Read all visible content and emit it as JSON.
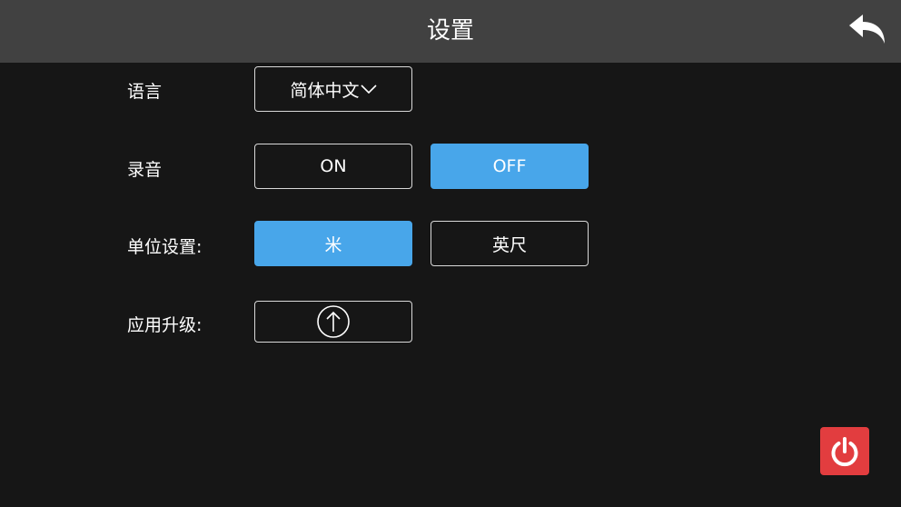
{
  "header": {
    "title": "设置"
  },
  "settings": {
    "language": {
      "label": "语言",
      "selected": "简体中文"
    },
    "recording": {
      "label": "录音",
      "options": [
        "ON",
        "OFF"
      ],
      "selected": "OFF"
    },
    "units": {
      "label": "单位设置:",
      "options": [
        "米",
        "英尺"
      ],
      "selected": "米"
    },
    "upgrade": {
      "label": "应用升级:"
    }
  },
  "colors": {
    "header_bg": "#414141",
    "page_bg": "#161616",
    "accent": "#48a6ea",
    "power": "#e23d3f"
  },
  "icons": {
    "back": "back-arrow-icon",
    "dropdown": "chevron-down-icon",
    "upgrade": "upload-arrow-icon",
    "power": "power-icon"
  }
}
